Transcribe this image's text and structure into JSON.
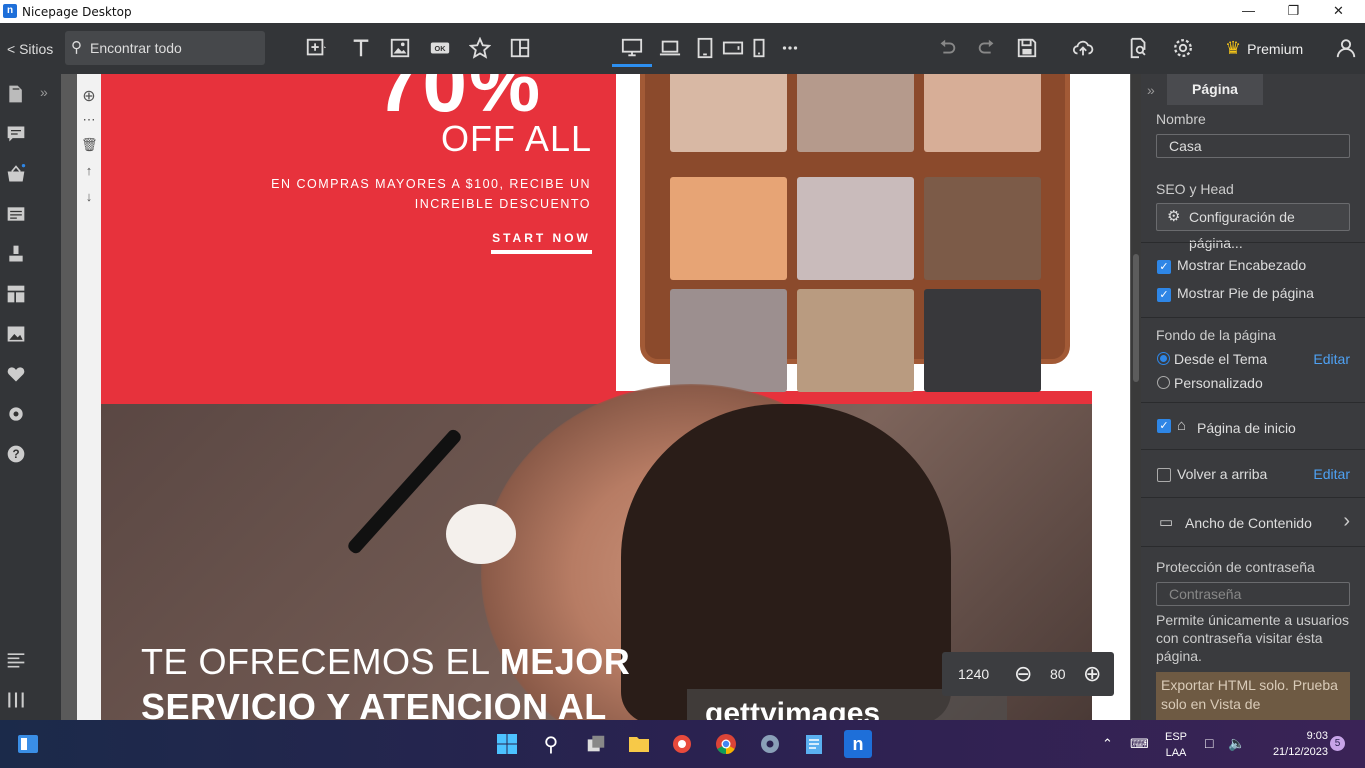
{
  "window": {
    "title": "Nicepage Desktop",
    "app_icon": "n"
  },
  "toolbar": {
    "sites_label": "< Sitios",
    "search_label": "Encontrar todo",
    "premium_label": "Premium"
  },
  "hero1": {
    "percent": "70%",
    "offall": "OFF ALL",
    "desc": "EN COMPRAS MAYORES A $100, RECIBE UN INCREIBLE DESCUENTO",
    "cta": "START NOW",
    "accent": "#e7323c"
  },
  "hero2": {
    "line1_light": "TE OFRECEMOS EL ",
    "line1_bold": "MEJOR",
    "line2_bold": "SERVICIO Y ATENCION AL",
    "watermark": "gettyimages"
  },
  "zoom": {
    "width": "1240",
    "level": "80"
  },
  "panel": {
    "tab": "Página",
    "name_label": "Nombre",
    "name_value": "Casa",
    "seo_label": "SEO y Head",
    "seo_button": "Configuración de página...",
    "show_header": "Mostrar Encabezado",
    "show_footer": "Mostrar Pie de página",
    "bg_label": "Fondo de la página",
    "bg_theme": "Desde el Tema",
    "bg_custom": "Personalizado",
    "edit": "Editar",
    "home_page": "Página de inicio",
    "back_to_top": "Volver a arriba",
    "content_width": "Ancho de Contenido",
    "password_label": "Protección de contraseña",
    "password_placeholder": "Contraseña",
    "password_help": "Permite únicamente a usuarios con contraseña visitar ésta página.",
    "export_note": "Exportar HTML solo. Prueba solo en Vista de"
  },
  "taskbar": {
    "lang1": "ESP",
    "lang2": "LAA",
    "time": "9:03",
    "date": "21/12/2023",
    "notif_count": "5"
  }
}
